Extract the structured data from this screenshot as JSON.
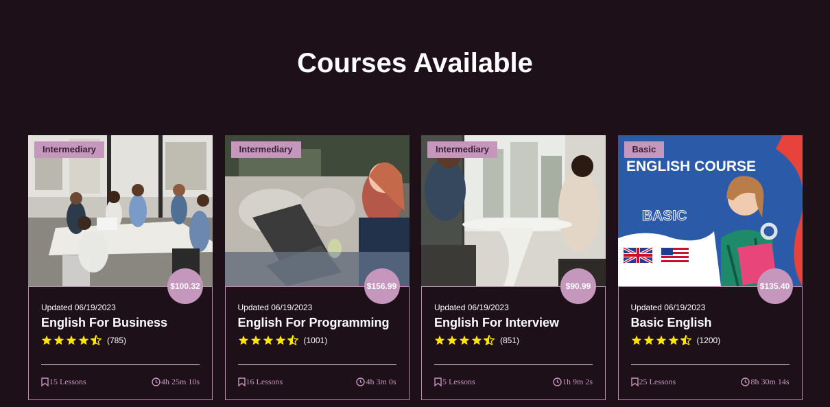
{
  "section": {
    "title": "Courses Available"
  },
  "colors": {
    "background": "#1e1019",
    "accent": "#c597bd",
    "star": "#ffe600",
    "text": "#ffffff"
  },
  "courses": [
    {
      "level": "Intermediary",
      "price": "$100.32",
      "updated": "Updated 06/19/2023",
      "title": "English For Business",
      "rating": 4.5,
      "rating_count": "(785)",
      "lessons": "15 Lessons",
      "duration": "4h 25m 10s",
      "image": "business-meeting-photo"
    },
    {
      "level": "Intermediary",
      "price": "$156.99",
      "updated": "Updated 06/19/2023",
      "title": "English For Programming",
      "rating": 4.5,
      "rating_count": "(1001)",
      "lessons": "16 Lessons",
      "duration": "4h 3m 0s",
      "image": "woman-headset-laptop-photo"
    },
    {
      "level": "Intermediary",
      "price": "$90.99",
      "updated": "Updated 06/19/2023",
      "title": "English For Interview",
      "rating": 4.5,
      "rating_count": "(851)",
      "lessons": "5 Lessons",
      "duration": "1h 9m 2s",
      "image": "interview-table-photo"
    },
    {
      "level": "Basic",
      "price": "$135.40",
      "updated": "Updated 06/19/2023",
      "title": "Basic English",
      "rating": 4.5,
      "rating_count": "(1200)",
      "lessons": "25 Lessons",
      "duration": "8h 30m 14s",
      "image": "english-course-banner",
      "banner_heading": "ENGLISH COURSE",
      "banner_sub": "BASIC"
    }
  ]
}
